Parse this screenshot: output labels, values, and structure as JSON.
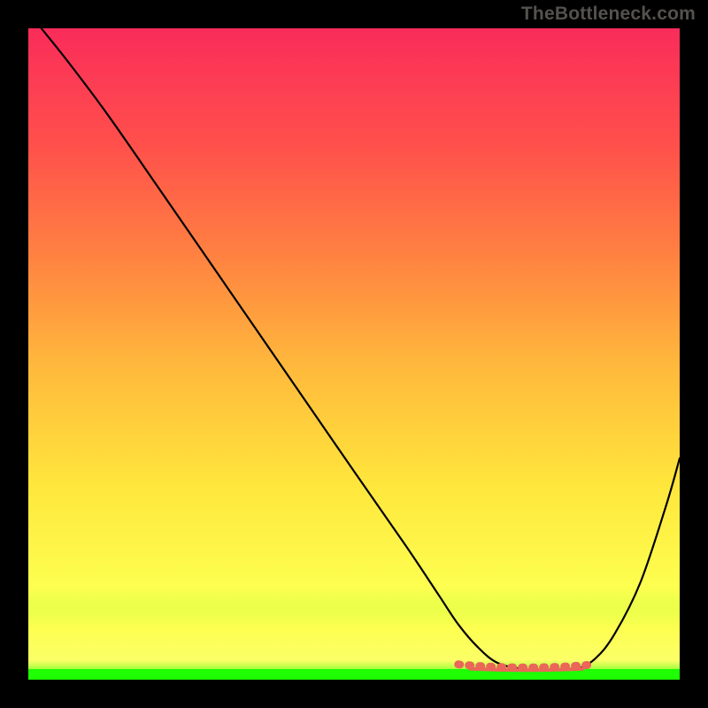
{
  "watermark": "TheBottleneck.com",
  "colors": {
    "background": "#000000",
    "curve": "#000000",
    "valley_marker": "#eb6659",
    "gradient_bottom": "#1eff03",
    "gradient_yellow": "#fdff50",
    "gradient_top": "#fa2c5a"
  },
  "chart_data": {
    "type": "line",
    "title": "",
    "xlabel": "",
    "ylabel": "",
    "xlim": [
      0,
      100
    ],
    "ylim": [
      0,
      100
    ],
    "grid": false,
    "legend": false,
    "series": [
      {
        "name": "bottleneck-curve",
        "x": [
          2,
          6,
          12,
          20,
          30,
          40,
          50,
          58,
          63,
          66,
          69,
          72,
          76,
          80,
          84,
          87,
          90,
          94,
          98,
          100
        ],
        "y": [
          100,
          95,
          87,
          75.5,
          61,
          46.5,
          32,
          20.5,
          13,
          8.5,
          5,
          2.6,
          1.6,
          1.6,
          1.6,
          3.2,
          7,
          15,
          27,
          34
        ]
      }
    ],
    "annotations": [
      {
        "name": "valley-flat-region",
        "x_range": [
          66,
          87
        ],
        "y": 1.8,
        "style": "dotted-coral"
      }
    ]
  }
}
